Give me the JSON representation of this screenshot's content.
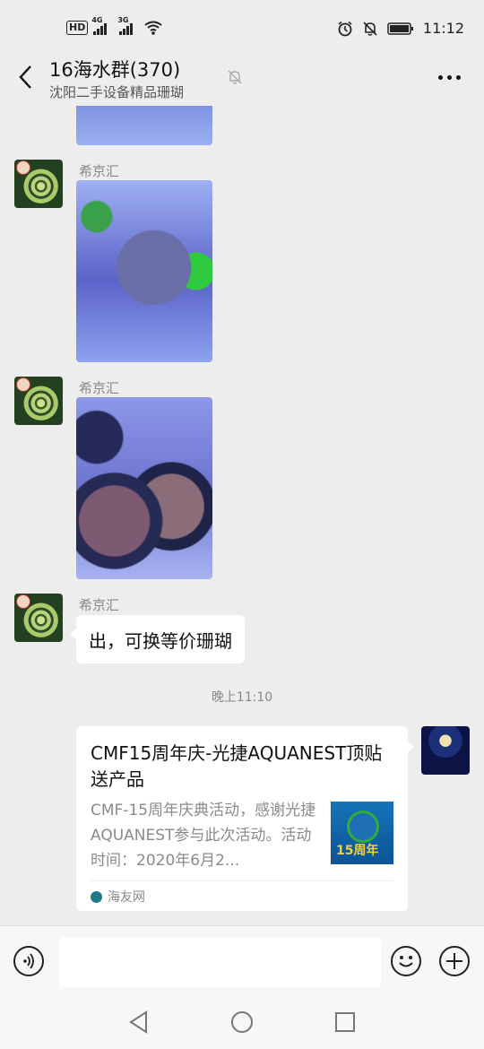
{
  "status_bar": {
    "left_labels": [
      "HD",
      "4G",
      "3G"
    ],
    "time": "11:12",
    "icons": [
      "hd-icon",
      "signal-4g-icon",
      "signal-3g-icon",
      "wifi-icon",
      "alarm-icon",
      "mute-bell-icon",
      "battery-icon"
    ]
  },
  "header": {
    "title": "16海水群(370)",
    "subtitle": "沈阳二手设备精品珊瑚",
    "icons": [
      "back-icon",
      "mute-icon",
      "more-icon"
    ]
  },
  "messages": [
    {
      "type": "image",
      "sender": "",
      "partial": true
    },
    {
      "type": "image",
      "sender": "希京汇"
    },
    {
      "type": "image",
      "sender": "希京汇"
    },
    {
      "type": "text",
      "sender": "希京汇",
      "text": "出，可换等价珊瑚"
    }
  ],
  "timestamp": "晚上11:10",
  "link_card": {
    "title": "CMF15周年庆-光捷AQUANEST顶贴送产品",
    "description": "CMF-15周年庆典活动，感谢光捷AQUANEST参与此次活动。活动时间：2020年6月2...",
    "thumb_text": "15周年",
    "source": "海友网"
  },
  "input_bar": {
    "placeholder": "",
    "icons": [
      "voice-icon",
      "emoji-icon",
      "plus-icon"
    ]
  },
  "system_nav": {
    "icons": [
      "nav-back-icon",
      "nav-home-icon",
      "nav-recents-icon"
    ]
  }
}
